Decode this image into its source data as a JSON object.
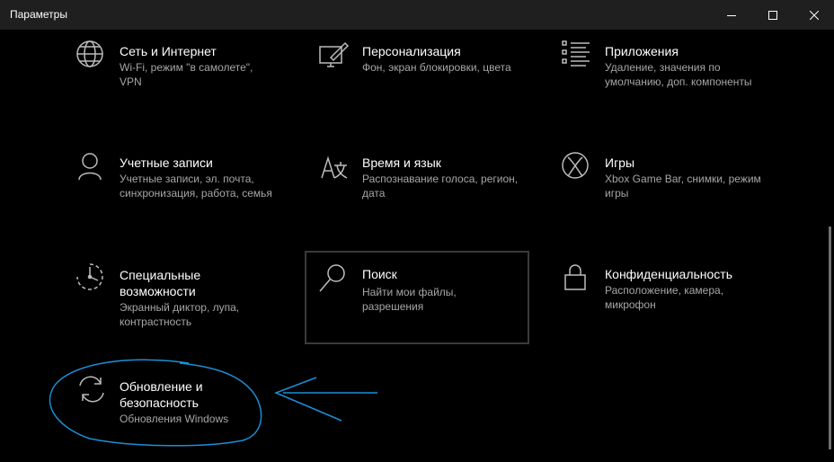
{
  "window": {
    "title": "Параметры"
  },
  "tiles": [
    {
      "label": "Сеть и Интернет",
      "desc": "Wi-Fi, режим \"в самолете\", VPN",
      "icon": "globe-icon"
    },
    {
      "label": "Персонализация",
      "desc": "Фон, экран блокировки, цвета",
      "icon": "personalization-icon"
    },
    {
      "label": "Приложения",
      "desc": "Удаление, значения по умолчанию, доп. компоненты",
      "icon": "apps-list-icon"
    },
    {
      "label": "Учетные записи",
      "desc": "Учетные записи, эл. почта, синхронизация, работа, семья",
      "icon": "person-icon"
    },
    {
      "label": "Время и язык",
      "desc": "Распознавание голоса, регион, дата",
      "icon": "time-language-icon"
    },
    {
      "label": "Игры",
      "desc": "Xbox Game Bar, снимки, режим игры",
      "icon": "xbox-icon"
    },
    {
      "label": "Специальные возможности",
      "desc": "Экранный диктор, лупа, контрастность",
      "icon": "ease-of-access-icon"
    },
    {
      "label": "Поиск",
      "desc": "Найти мои файлы, разрешения",
      "icon": "search-icon"
    },
    {
      "label": "Конфиденциальность",
      "desc": "Расположение, камера, микрофон",
      "icon": "lock-icon"
    },
    {
      "label": "Обновление и безопасность",
      "desc": "Обновления Windows",
      "icon": "update-refresh-icon"
    }
  ],
  "colors": {
    "background": "#000000",
    "titlebar": "#1f1f1f",
    "description_text": "#a6a6a6",
    "annotation": "#1b8fd6"
  }
}
